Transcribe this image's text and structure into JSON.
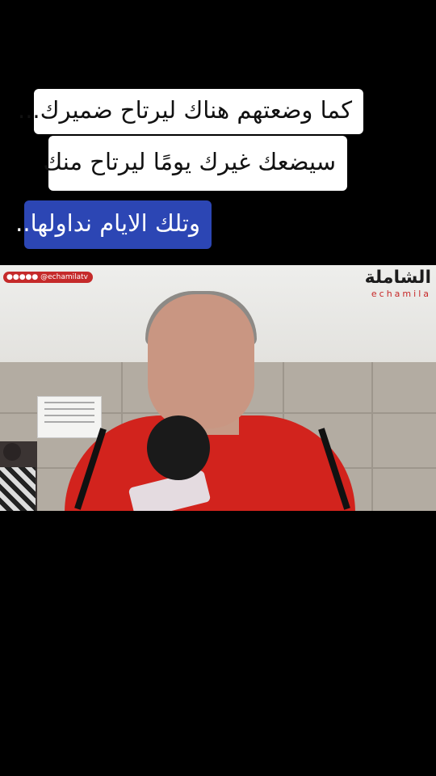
{
  "captions": {
    "line1": "كما وضعتهم هناك ليرتاح ضميرك...",
    "line2": "سيضعك غيرك يومًا ليرتاح منك",
    "line3": "وتلك الايام نداولها.."
  },
  "video": {
    "social_handle": "@echamilatv",
    "brand_arabic": "الشاملة",
    "brand_latin": "echamila"
  },
  "colors": {
    "background": "#000000",
    "caption_white": "#ffffff",
    "caption_blue": "#2c46b4",
    "brand_red": "#c72828"
  }
}
